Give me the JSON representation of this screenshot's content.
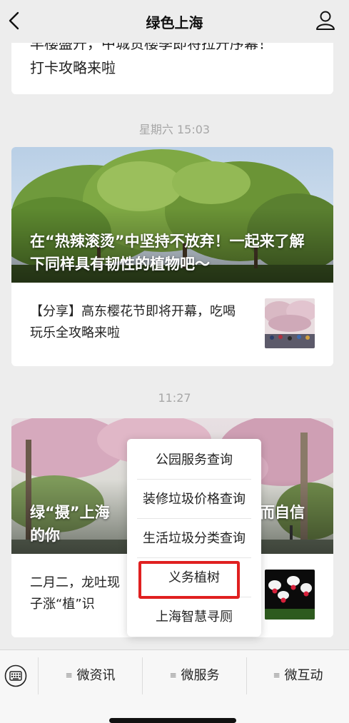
{
  "nav": {
    "title": "绿色上海"
  },
  "top_card": {
    "line1": "早樱盛开，中城贯樱季即将拉开序幕！",
    "line2": "打卡攻略来啦"
  },
  "group1": {
    "timestamp": "星期六 15:03",
    "hero_title": "在“热辣滚烫”中坚持不放弃！一起来了解下同样具有韧性的植物吧～",
    "sub_title": "【分享】高东樱花节即将开幕，吃喝玩乐全攻略来啦"
  },
  "group2": {
    "timestamp": "11:27",
    "hero_title_left": "绿“摄”上海",
    "hero_title_right": "而自信",
    "hero_title_line2": "的你",
    "sub_text_line1": "二月二，龙吐现",
    "sub_text_line2": "子涨“植”识"
  },
  "popup_menu": {
    "items": [
      "公园服务查询",
      "装修垃圾价格查询",
      "生活垃圾分类查询",
      "义务植树",
      "上海智慧寻厕"
    ],
    "highlighted_index": 3,
    "highlight_color": "#e02020"
  },
  "bottom_menu": {
    "tabs": [
      "微资讯",
      "微服务",
      "微互动"
    ]
  },
  "colors": {
    "background": "#ededed",
    "card": "#ffffff",
    "timestamp": "#a7a7a7"
  },
  "icons": [
    "back-icon",
    "user-icon",
    "keyboard-icon",
    "menu-lines-icon"
  ]
}
